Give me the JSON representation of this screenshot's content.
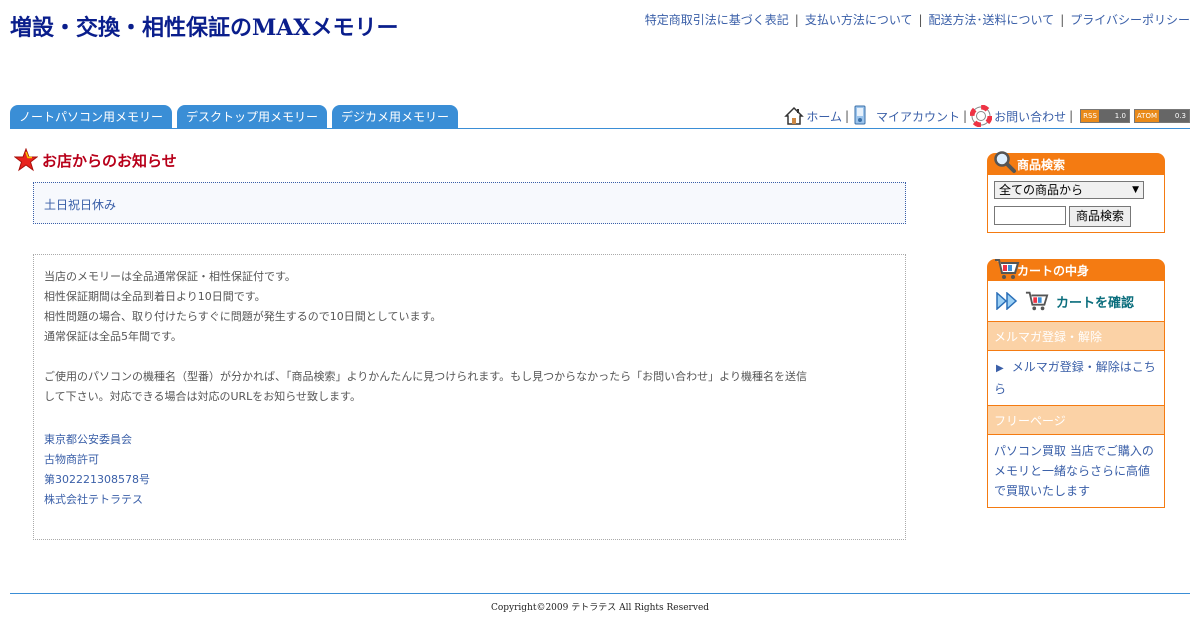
{
  "header": {
    "site_title": "増設・交換・相性保証のMAXメモリー",
    "top_links": [
      "特定商取引法に基づく表記",
      "支払い方法について",
      "配送方法･送料について",
      "プライバシーポリシー"
    ],
    "separator": "|"
  },
  "nav": {
    "tabs": [
      "ノートパソコン用メモリー",
      "デスクトップ用メモリー",
      "デジカメ用メモリー"
    ]
  },
  "utility": {
    "home": "ホーム",
    "account": "マイアカウント",
    "contact": "お問い合わせ",
    "rss_left": "RSS",
    "rss_right": "1.0",
    "atom_left": "ATOM",
    "atom_right": "0.3"
  },
  "notice": {
    "title": "お店からのお知らせ",
    "box_text": "土日祝日休み"
  },
  "info": {
    "lines1": [
      "当店のメモリーは全品通常保証・相性保証付です。",
      "相性保証期間は全品到着日より10日間です。",
      "相性問題の場合、取り付けたらすぐに問題が発生するので10日間としています。",
      "通常保証は全品5年間です。"
    ],
    "lines2": [
      "ご使用のパソコンの機種名（型番）が分かれば、「商品検索」よりかんたんに見つけられます。もし見つからなかったら「お問い合わせ」より機種名を送信",
      "して下さい。対応できる場合は対応のURLをお知らせ致します。"
    ],
    "registration": [
      "東京都公安委員会",
      "古物商許可",
      "第302221308578号",
      "株式会社テトラテス"
    ]
  },
  "sidebar": {
    "search_title": "商品検索",
    "search_select": "全ての商品から",
    "search_button": "商品検索",
    "cart_title": "カートの中身",
    "cart_link": "カートを確認",
    "mail_title": "メルマガ登録・解除",
    "mail_link": "メルマガ登録・解除はこちら",
    "free_title": "フリーページ",
    "free_text": "パソコン買取 当店でご購入のメモリと一緒ならさらに高値で買取いたします"
  },
  "footer": {
    "copyright": "Copyright©2009 テトラテス All Rights Reserved"
  },
  "colors": {
    "title_blue": "#0a1e8c",
    "link_blue": "#3a5fa8",
    "tab_blue": "#3a8ed6",
    "side_orange": "#f47b12",
    "notice_red": "#b8001a"
  }
}
